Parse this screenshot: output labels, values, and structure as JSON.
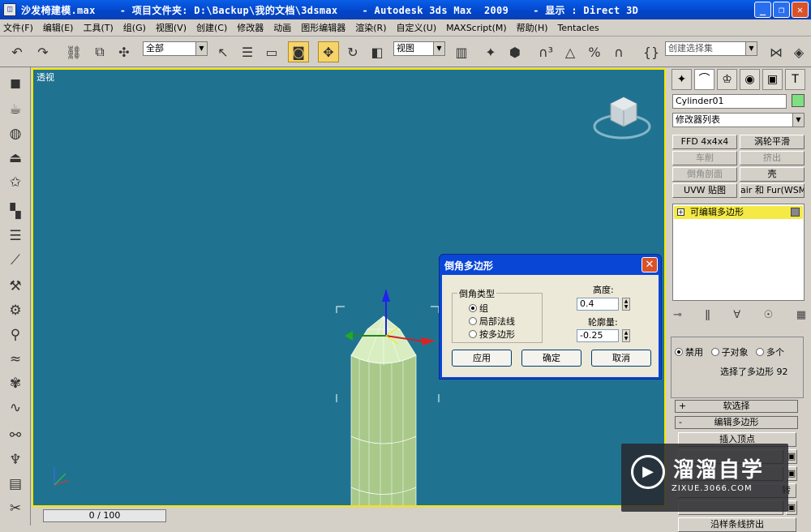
{
  "window": {
    "title": "沙发椅建模.max    - 项目文件夹: D:\\Backup\\我的文档\\3dsmax    - Autodesk 3ds Max  2009    - 显示 : Direct 3D",
    "minimize": "_",
    "maximize": "❐",
    "close": "✕"
  },
  "menu": [
    "文件(F)",
    "编辑(E)",
    "工具(T)",
    "组(G)",
    "视图(V)",
    "创建(C)",
    "修改器",
    "动画",
    "图形编辑器",
    "渲染(R)",
    "自定义(U)",
    "MAXScript(M)",
    "帮助(H)",
    "Tentacles"
  ],
  "toolbar": {
    "selection_filter": "全部",
    "reference_coord": "视图",
    "named_selection": "创建选择集"
  },
  "viewport": {
    "label": "透视",
    "background": "#1f7391"
  },
  "status": {
    "time": "0 / 100"
  },
  "command_panel": {
    "object_name": "Cylinder01",
    "object_color": "#7fe07f",
    "modifier_list": "修改器列表",
    "modifier_buttons": [
      {
        "label": "FFD 4x4x4",
        "disabled": false
      },
      {
        "label": "涡轮平滑",
        "disabled": false
      },
      {
        "label": "车削",
        "disabled": true
      },
      {
        "label": "挤出",
        "disabled": true
      },
      {
        "label": "倒角剖面",
        "disabled": true
      },
      {
        "label": "壳",
        "disabled": false
      },
      {
        "label": "UVW 贴图",
        "disabled": false
      },
      {
        "label": "air 和 Fur(WSM)",
        "disabled": false
      }
    ],
    "stack_item": "可编辑多边形",
    "selection_mode": {
      "disable": "禁用",
      "subobject": "子对象",
      "multiple": "多个"
    },
    "selection_info": "选择了多边形 92",
    "rollouts": {
      "soft_selection": "软选择",
      "edit_polygons": "编辑多边形"
    },
    "edit_buttons": {
      "insert_vertex": "插入顶点",
      "rotate_fragment": "转",
      "extrude_along_spline": "沿样条线挤出"
    }
  },
  "dialog": {
    "title": "倒角多边形",
    "group_title": "倒角类型",
    "options": [
      "组",
      "局部法线",
      "按多边形"
    ],
    "selected_option": 0,
    "height_label": "高度:",
    "height_value": "0.4",
    "outline_label": "轮廓量:",
    "outline_value": "-0.25",
    "buttons": {
      "apply": "应用",
      "ok": "确定",
      "cancel": "取消"
    }
  },
  "watermark": {
    "name": "溜溜自学",
    "url": "ZIXUE.3066.COM"
  }
}
